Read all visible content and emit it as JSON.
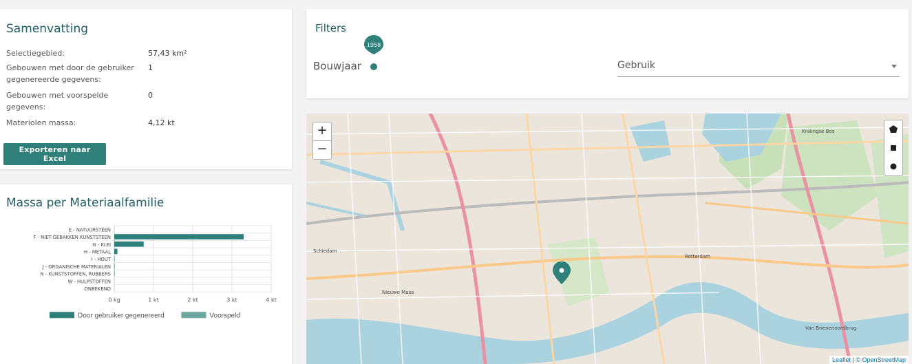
{
  "summary": {
    "title": "Samenvatting",
    "rows": [
      {
        "label": "Selectiegebied:",
        "value": "57,43 km²"
      },
      {
        "label_1": "Gebouwen met door de gebruiker",
        "label_2": "gegenereerde gegevens:",
        "value": "1"
      },
      {
        "label_1": "Gebouwen met voorspelde",
        "label_2": "gegevens:",
        "value": "0"
      },
      {
        "label": "Materiolen massa:",
        "value": "4,12 kt"
      }
    ],
    "export_label": "Exporteren naar Excel"
  },
  "filters": {
    "title": "Filters",
    "bouwjaar_label": "Bouwjaar",
    "bouwjaar_value": "1958",
    "gebruik_label": "Gebruik"
  },
  "map": {
    "zoom_in": "+",
    "zoom_out": "−",
    "attribution": "Leaflet | © OpenStreetMap",
    "labels": [
      "Schiedam",
      "Nieuwe Maas",
      "Rotterdam",
      "Kralingse Bos",
      "Van Brienenoordbrug"
    ]
  },
  "chart_data": {
    "type": "bar",
    "title": "Massa per Materiaalfamilie",
    "orientation": "horizontal",
    "categories": [
      "E - NATUURSTEEN",
      "F - NIET-GEBAKKEN KUNSTSTEEN",
      "G - KLEI",
      "H - METAAL",
      "I - HOUT",
      "J - ORGANISCHE MATERIALEN",
      "N - KUNSTSTOFFEN, RUBBERS",
      "W - HULPSTOFFEN",
      "ONBEKEND"
    ],
    "series": [
      {
        "name": "Door gebruiker gegenereerd",
        "values": [
          0,
          3.3,
          0.75,
          0.08,
          0.01,
          0.01,
          0.01,
          0,
          0
        ],
        "color": "#2f7f7a"
      },
      {
        "name": "Voorspeld",
        "values": [
          0,
          0,
          0,
          0,
          0,
          0,
          0,
          0,
          0
        ],
        "color": "#6fa8a1"
      }
    ],
    "xticks": [
      "0 kg",
      "1 kt",
      "2 kt",
      "3 kt",
      "4 kt"
    ],
    "xlim": [
      0,
      4
    ],
    "grid": true,
    "legend": "bottom"
  }
}
